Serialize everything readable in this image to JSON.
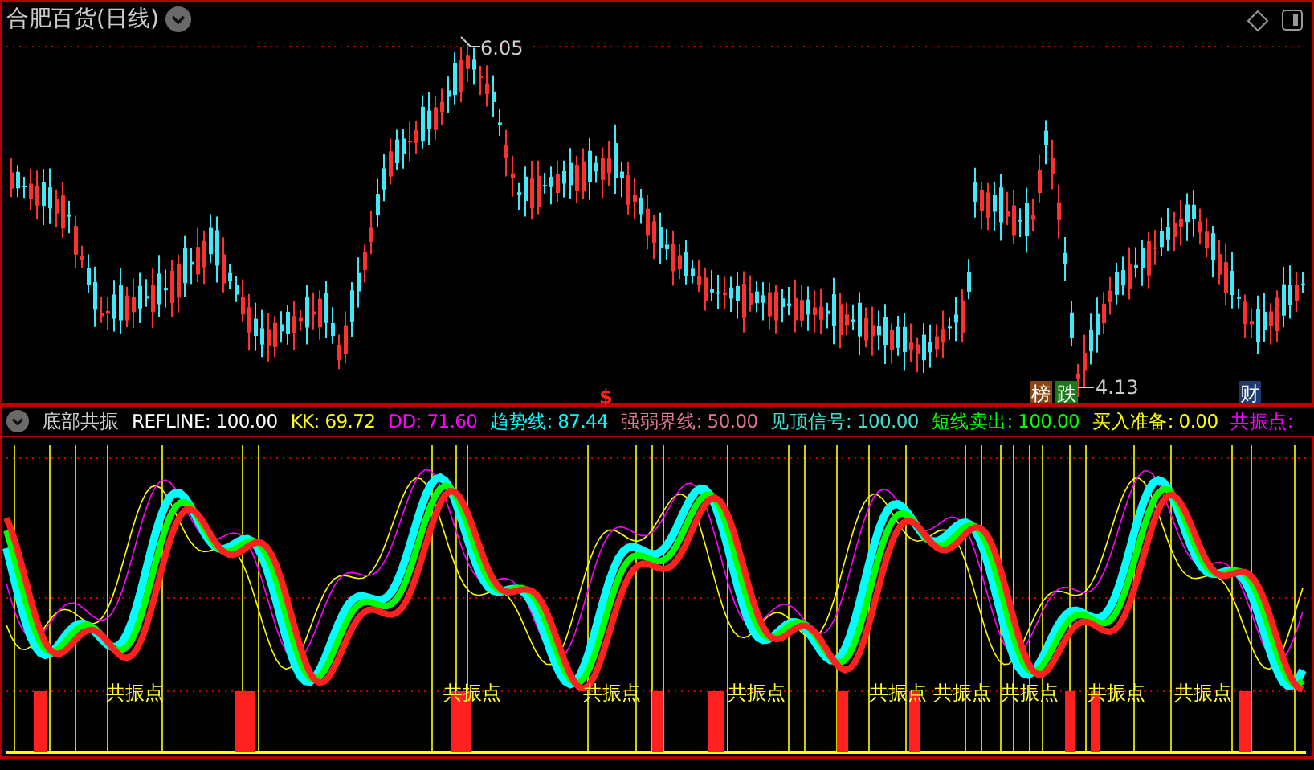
{
  "price_panel": {
    "title": "合肥百货(日线)",
    "high_label": "6.05",
    "low_label": "4.13",
    "markers": [
      {
        "text": "$",
        "kind": "signal",
        "color": "#ff2020"
      },
      {
        "text": "榜",
        "kind": "tag",
        "color": "#8b4513"
      },
      {
        "text": "跌",
        "kind": "tag",
        "color": "#1a7a1a"
      },
      {
        "text": "财",
        "kind": "tag",
        "color": "#1e3a6e"
      }
    ]
  },
  "indicator_panel": {
    "title": "底部共振",
    "readouts": [
      {
        "text": "REFLINE: 100.00",
        "color": "#ffffff"
      },
      {
        "text": "KK: 69.72",
        "color": "#ffff00"
      },
      {
        "text": "DD: 71.60",
        "color": "#ff00ff"
      },
      {
        "text": "趋势线: 87.44",
        "color": "#00ffff"
      },
      {
        "text": "强弱界线: 50.00",
        "color": "#e07890"
      },
      {
        "text": "见顶信号: 100.00",
        "color": "#40e0d0"
      },
      {
        "text": "短线卖出: 100.00",
        "color": "#00ff00"
      },
      {
        "text": "买入准备: 0.00",
        "color": "#ffff00"
      },
      {
        "text": "共振点:",
        "color": "#ff00ff"
      }
    ],
    "signal_labels": [
      "共振点",
      "共振点",
      "共振点",
      "共振点",
      "共振点",
      "共振点",
      "共振点",
      "共振点",
      "共振点"
    ]
  }
}
